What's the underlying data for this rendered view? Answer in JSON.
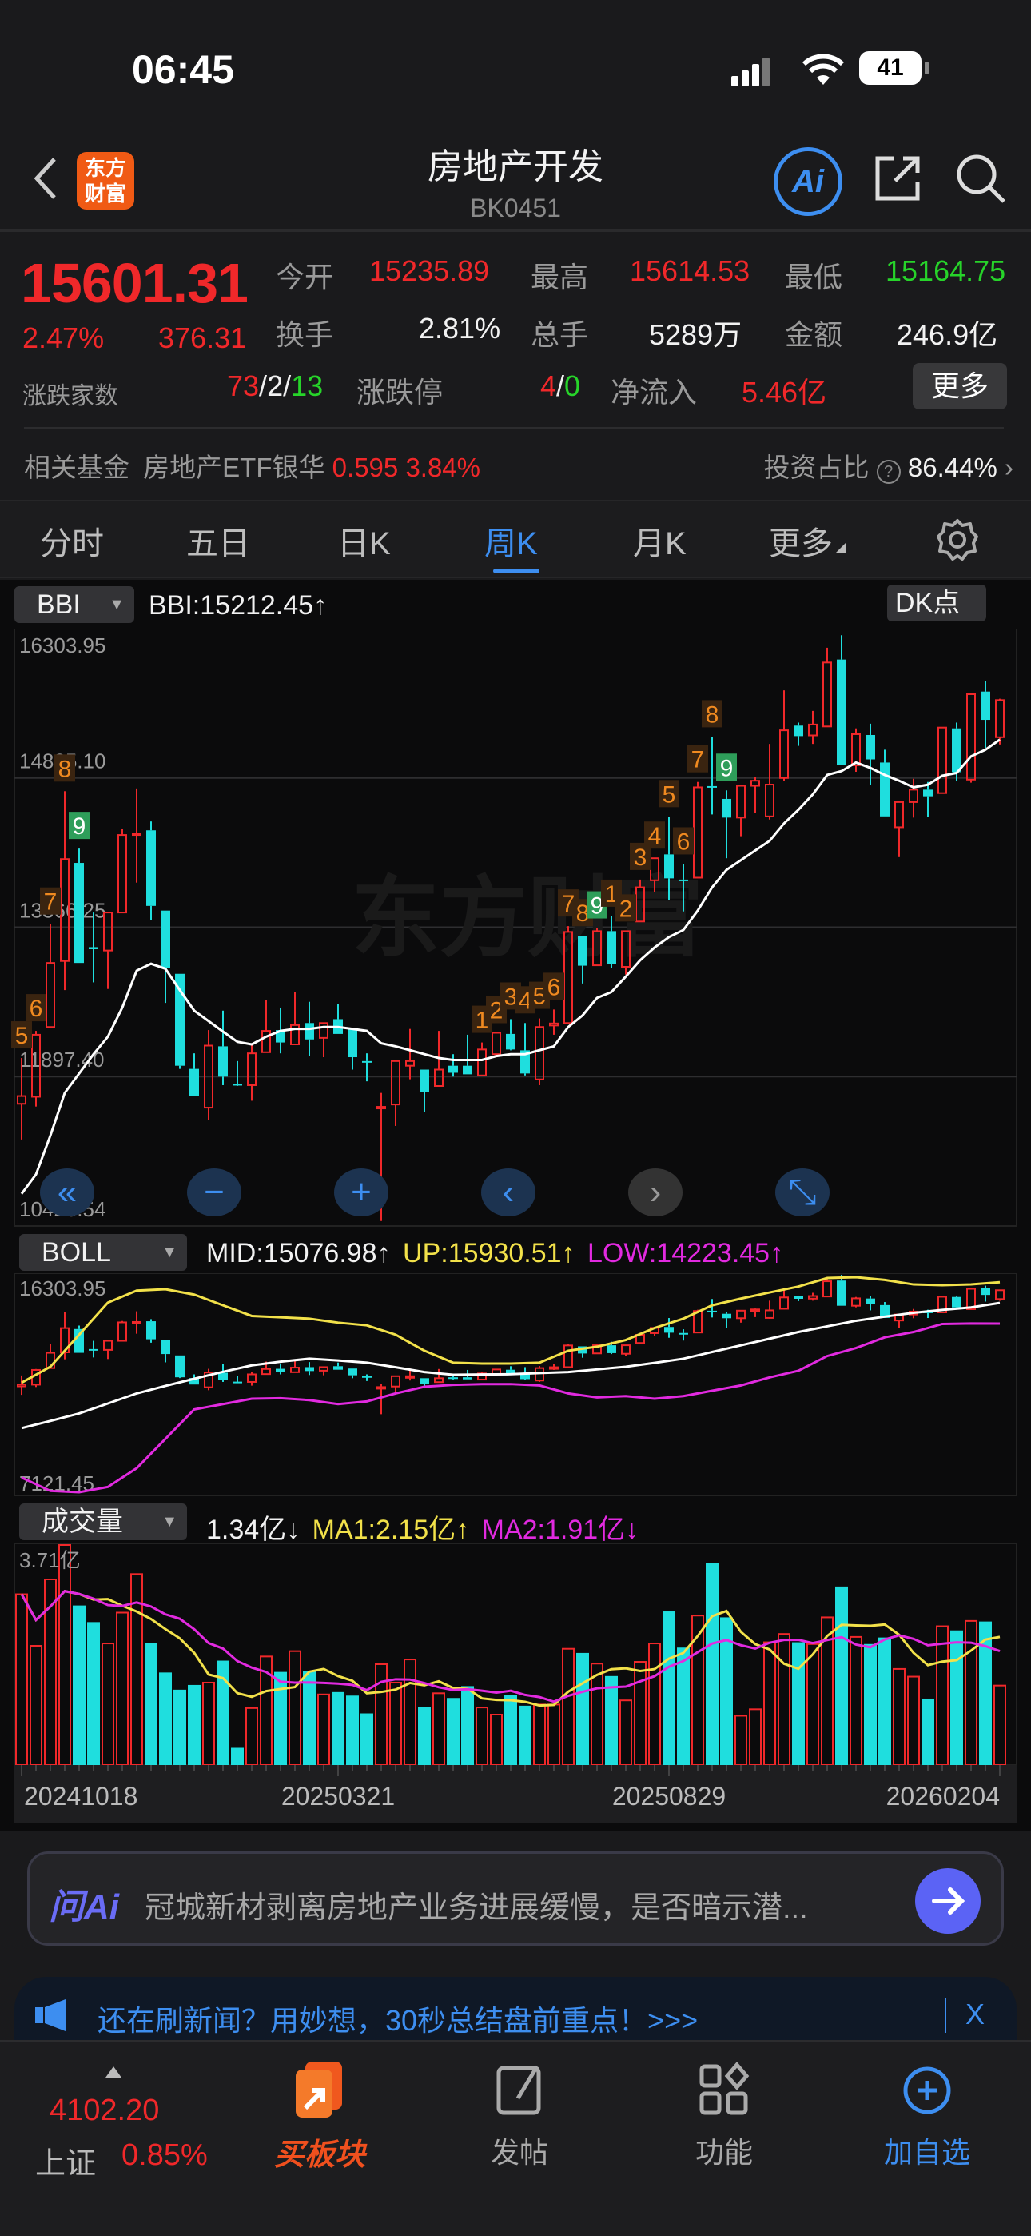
{
  "status": {
    "time": "06:45",
    "battery": "41"
  },
  "header": {
    "title": "房地产开发",
    "code": "BK0451",
    "logo": "东方财富"
  },
  "quote": {
    "price": "15601.31",
    "change_pct": "2.47%",
    "change": "376.31",
    "open_label": "今开",
    "open": "15235.89",
    "high_label": "最高",
    "high": "15614.53",
    "low_label": "最低",
    "low": "15164.75",
    "turnover_label": "换手",
    "turnover": "2.81%",
    "volume_label": "总手",
    "volume": "5289万",
    "amount_label": "金额",
    "amount": "246.9亿",
    "breadth_label": "涨跌家数",
    "breadth_up": "73",
    "breadth_flat": "2",
    "breadth_down": "13",
    "limit_label": "涨跌停",
    "limit_up": "4",
    "limit_down": "0",
    "netflow_label": "净流入",
    "netflow": "5.46亿",
    "more": "更多",
    "sep": "/",
    "fund_label": "相关基金",
    "fund_name": "房地产ETF银华",
    "fund_price": "0.595",
    "fund_pct": "3.84%",
    "ratio_label": "投资占比",
    "ratio": "86.44%"
  },
  "tabs": [
    {
      "label": "分时"
    },
    {
      "label": "五日"
    },
    {
      "label": "日K"
    },
    {
      "label": "周K",
      "active": true
    },
    {
      "label": "月K"
    },
    {
      "label": "更多"
    }
  ],
  "main_indicator": {
    "name": "BBI",
    "value": "BBI:15212.45",
    "arrow": "↑",
    "dk": "DK点"
  },
  "boll_indicator": {
    "name": "BOLL",
    "mid": "MID:15076.98",
    "up": "UP:15930.51",
    "low": "LOW:14223.45",
    "arrow": "↑"
  },
  "vol_indicator": {
    "name": "成交量",
    "value": "1.34亿",
    "v_arrow": "↓",
    "ma1": "MA1:2.15亿",
    "ma1_arrow": "↑",
    "ma2": "MA2:1.91亿",
    "ma2_arrow": "↓"
  },
  "colors": {
    "up": "#f0282a",
    "down": "#1fdede",
    "bbi": "#ffffff",
    "boll_up": "#f2e14a",
    "boll_mid": "#ffffff",
    "boll_low": "#e22ae0",
    "ma1": "#f2e14a",
    "ma2": "#e22ae0",
    "accent": "#3d8ef0"
  },
  "chart_data": {
    "type": "candlestick",
    "period": "weekly",
    "main_ylim": [
      10428.54,
      16303.95
    ],
    "main_ticks": [
      "16303.95",
      "14835.10",
      "13366.25",
      "11897.40",
      "10428.54"
    ],
    "candles": [
      [
        11630,
        12080,
        11279,
        11706
      ],
      [
        11699,
        12347,
        11603,
        12309
      ],
      [
        12385,
        13396,
        12385,
        13015
      ],
      [
        13034,
        14705,
        12748,
        14037
      ],
      [
        13999,
        14140,
        13015,
        13015
      ],
      [
        13170,
        13511,
        12824,
        13150
      ],
      [
        13137,
        13511,
        12759,
        13511
      ],
      [
        13511,
        14331,
        13511,
        14274
      ],
      [
        14280,
        14732,
        13805,
        14290
      ],
      [
        14320,
        14407,
        13435,
        13576
      ],
      [
        13530,
        13530,
        12622,
        12965
      ],
      [
        12908,
        12908,
        11973,
        12004
      ],
      [
        11973,
        12126,
        11706,
        11706
      ],
      [
        11592,
        12355,
        11470,
        12202
      ],
      [
        12195,
        12546,
        11813,
        11897
      ],
      [
        11825,
        12050,
        11806,
        11821
      ],
      [
        11813,
        12214,
        11660,
        12126
      ],
      [
        12137,
        12653,
        12137,
        12347
      ],
      [
        12355,
        12576,
        12126,
        12233
      ],
      [
        12214,
        12729,
        12214,
        12404
      ],
      [
        12424,
        12633,
        12099,
        12263
      ],
      [
        12278,
        12424,
        12088,
        12424
      ],
      [
        12462,
        12614,
        12317,
        12317
      ],
      [
        12366,
        12366,
        11966,
        12088
      ],
      [
        12050,
        12126,
        11851,
        12046
      ],
      [
        11590,
        11737,
        10478,
        11600
      ],
      [
        11623,
        12050,
        11412,
        12050
      ],
      [
        12004,
        12366,
        11871,
        12050
      ],
      [
        11966,
        11966,
        11546,
        11745
      ],
      [
        11805,
        12347,
        11805,
        11966
      ],
      [
        12004,
        12118,
        11897,
        11935
      ],
      [
        12004,
        12309,
        11920,
        11920
      ],
      [
        11909,
        12233,
        11909,
        12164
      ],
      [
        12118,
        12328,
        12118,
        12328
      ],
      [
        12317,
        12462,
        12156,
        12164
      ],
      [
        12156,
        12424,
        11909,
        11928
      ],
      [
        11870,
        12469,
        11813,
        12385
      ],
      [
        12400,
        12557,
        12309,
        12420
      ],
      [
        12424,
        13377,
        12424,
        13320
      ],
      [
        13282,
        13282,
        12813,
        12988
      ],
      [
        12992,
        13358,
        12992,
        13328
      ],
      [
        13328,
        13473,
        12965,
        13003
      ],
      [
        12977,
        13328,
        12900,
        13328
      ],
      [
        13423,
        13835,
        13423,
        13759
      ],
      [
        13828,
        14045,
        13713,
        14045
      ],
      [
        14083,
        14453,
        13637,
        13847
      ],
      [
        13835,
        13988,
        13522,
        13833
      ],
      [
        13854,
        14796,
        13854,
        14743
      ],
      [
        14755,
        15239,
        14476,
        14750
      ],
      [
        14629,
        14713,
        14045,
        14445
      ],
      [
        14445,
        14758,
        14262,
        14758
      ],
      [
        14758,
        14846,
        14491,
        14808
      ],
      [
        14457,
        15170,
        14426,
        14770
      ],
      [
        14835,
        15697,
        14808,
        15304
      ],
      [
        15350,
        15380,
        15151,
        15247
      ],
      [
        15254,
        15495,
        15170,
        15361
      ],
      [
        15342,
        16116,
        15342,
        15971
      ],
      [
        16000,
        16239,
        14960,
        14960
      ],
      [
        14960,
        15323,
        14896,
        15266
      ],
      [
        15258,
        15369,
        14770,
        15018
      ],
      [
        14987,
        15113,
        14457,
        14457
      ],
      [
        14350,
        14598,
        14056,
        14598
      ],
      [
        14598,
        14827,
        14445,
        14720
      ],
      [
        14720,
        14796,
        14453,
        14655
      ],
      [
        14686,
        15331,
        14686,
        15331
      ],
      [
        15323,
        15380,
        14808,
        14892
      ],
      [
        14819,
        15659,
        14789,
        15659
      ],
      [
        15685,
        15788,
        15132,
        15407
      ],
      [
        15235.89,
        15614.53,
        15164.75,
        15601.31
      ]
    ],
    "bbi": [
      10745,
      10936,
      11317,
      11737,
      11928,
      12118,
      12290,
      12576,
      12939,
      13007,
      12958,
      12748,
      12546,
      12443,
      12340,
      12240,
      12214,
      12290,
      12347,
      12366,
      12366,
      12385,
      12385,
      12366,
      12347,
      12225,
      12195,
      12157,
      12118,
      12080,
      12061,
      12061,
      12061,
      12099,
      12118,
      12118,
      12157,
      12195,
      12385,
      12500,
      12671,
      12729,
      12881,
      13042,
      13167,
      13270,
      13339,
      13530,
      13759,
      13931,
      14026,
      14121,
      14217,
      14388,
      14522,
      14674,
      14865,
      14903,
      14987,
      14934,
      14865,
      14808,
      14743,
      14769,
      14857,
      14884,
      15048,
      15113,
      15212.45
    ],
    "td_marks": [
      {
        "i": 0,
        "n": "5"
      },
      {
        "i": 1,
        "n": "6"
      },
      {
        "i": 2,
        "n": "7"
      },
      {
        "i": 3,
        "n": "8"
      },
      {
        "i": 4,
        "n": "9"
      },
      {
        "i": 32,
        "n": "1"
      },
      {
        "i": 33,
        "n": "2"
      },
      {
        "i": 34,
        "n": "3"
      },
      {
        "i": 35,
        "n": "4"
      },
      {
        "i": 36,
        "n": "5"
      },
      {
        "i": 37,
        "n": "6"
      },
      {
        "i": 38,
        "n": "7"
      },
      {
        "i": 39,
        "n": "8"
      },
      {
        "i": 40,
        "n": "9"
      },
      {
        "i": 41,
        "n": "1"
      },
      {
        "i": 42,
        "n": "2"
      },
      {
        "i": 43,
        "n": "3"
      },
      {
        "i": 44,
        "n": "4"
      },
      {
        "i": 45,
        "n": "5"
      },
      {
        "i": 46,
        "n": "6"
      },
      {
        "i": 47,
        "n": "7"
      },
      {
        "i": 48,
        "n": "8"
      },
      {
        "i": 49,
        "n": "9"
      }
    ],
    "boll_ylim": [
      7121.45,
      16303.95
    ],
    "boll_ticks": [
      "16303.95",
      "7121.45"
    ],
    "boll_sample_step": 2,
    "boll_up": [
      11779,
      12441,
      13765,
      15090,
      15586,
      15642,
      15421,
      14979,
      14538,
      14483,
      14427,
      14262,
      14151,
      13765,
      13103,
      12607,
      12573,
      12573,
      12607,
      13103,
      13268,
      13544,
      14041,
      14427,
      14979,
      15255,
      15510,
      15752,
      16105,
      16138,
      16028,
      15840,
      15807,
      15840,
      15930.51
    ],
    "boll_mid": [
      9902,
      10200,
      10509,
      10920,
      11337,
      11650,
      11944,
      12230,
      12496,
      12650,
      12772,
      12700,
      12607,
      12420,
      12220,
      12110,
      12120,
      12132,
      12180,
      12220,
      12330,
      12441,
      12600,
      12772,
      13050,
      13324,
      13600,
      13876,
      14110,
      14340,
      14510,
      14670,
      14790,
      14891,
      15076.98
    ],
    "boll_low": [
      7861,
      7309,
      7253,
      7474,
      8247,
      9461,
      10675,
      10896,
      11117,
      11139,
      11061,
      10896,
      11006,
      11337,
      11613,
      11690,
      11723,
      11723,
      11668,
      11337,
      11172,
      11227,
      11117,
      11227,
      11448,
      11668,
      11999,
      12275,
      12882,
      13213,
      13655,
      13876,
      14207,
      14229,
      14223.45
    ],
    "volume_max_label": "3.71亿",
    "volume_ylim": [
      0,
      3.71
    ],
    "volume_unit": "亿",
    "volumes": [
      2.88,
      2.01,
      3.13,
      3.71,
      2.69,
      2.41,
      2.05,
      2.57,
      3.22,
      2.06,
      1.56,
      1.27,
      1.35,
      1.39,
      1.76,
      0.29,
      0.96,
      1.83,
      1.57,
      1.92,
      1.59,
      1.19,
      1.23,
      1.17,
      0.87,
      1.7,
      1.39,
      1.78,
      0.98,
      1.21,
      1.13,
      1.33,
      0.97,
      0.85,
      1.18,
      1.0,
      1.02,
      1.02,
      1.96,
      1.89,
      1.71,
      1.5,
      1.09,
      1.74,
      2.05,
      2.59,
      1.98,
      2.52,
      3.41,
      2.49,
      0.83,
      0.94,
      2.07,
      2.21,
      2.07,
      2.04,
      2.49,
      3.01,
      2.16,
      2.04,
      2.15,
      1.62,
      1.49,
      1.12,
      2.34,
      2.27,
      2.43,
      2.42,
      1.34
    ],
    "ma_periods": [
      5,
      10
    ],
    "x_labels": [
      {
        "i": 0,
        "label": "20241018"
      },
      {
        "i": 22,
        "label": "20250321"
      },
      {
        "i": 45,
        "label": "20250829"
      },
      {
        "i": 68,
        "label": "20260204"
      }
    ]
  },
  "ai": {
    "brand": "问Ai",
    "prompt": "冠城新材剥离房地产业务进展缓慢，是否暗示潜..."
  },
  "notice": {
    "text": "还在刷新闻？用妙想，30秒总结盘前重点！>>>",
    "close": "X"
  },
  "bottom": {
    "index_value": "4102.20",
    "index_name": "上证",
    "index_pct": "0.85%",
    "buy": "买板块",
    "post": "发帖",
    "func": "功能",
    "add": "加自选"
  }
}
